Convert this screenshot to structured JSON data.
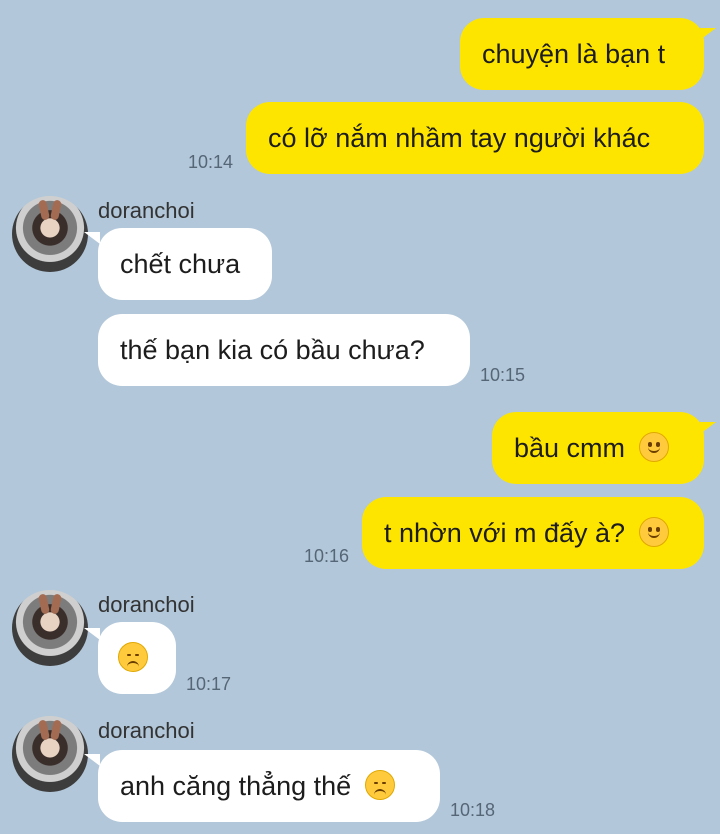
{
  "contact": {
    "name": "doranchoi"
  },
  "messages": [
    {
      "text": "chuyện là bạn t"
    },
    {
      "text": "có lỡ nắm nhầm tay người khác",
      "time": "10:14"
    },
    {
      "text": "chết chưa"
    },
    {
      "text": "thế bạn kia có bầu chưa?",
      "time": "10:15"
    },
    {
      "text": "bầu cmm",
      "emoji": "slightly-smiling-face-icon"
    },
    {
      "text": "t nhờn với m đấy à?",
      "emoji": "slightly-smiling-face-icon",
      "time": "10:16"
    },
    {
      "emoji": "disappointed-face-icon",
      "time": "10:17"
    },
    {
      "text": "anh căng thẳng thế",
      "emoji": "disappointed-face-icon",
      "time": "10:18"
    }
  ],
  "colors": {
    "background": "#b2c7d9",
    "mine_bubble": "#fee500",
    "their_bubble": "#ffffff"
  }
}
